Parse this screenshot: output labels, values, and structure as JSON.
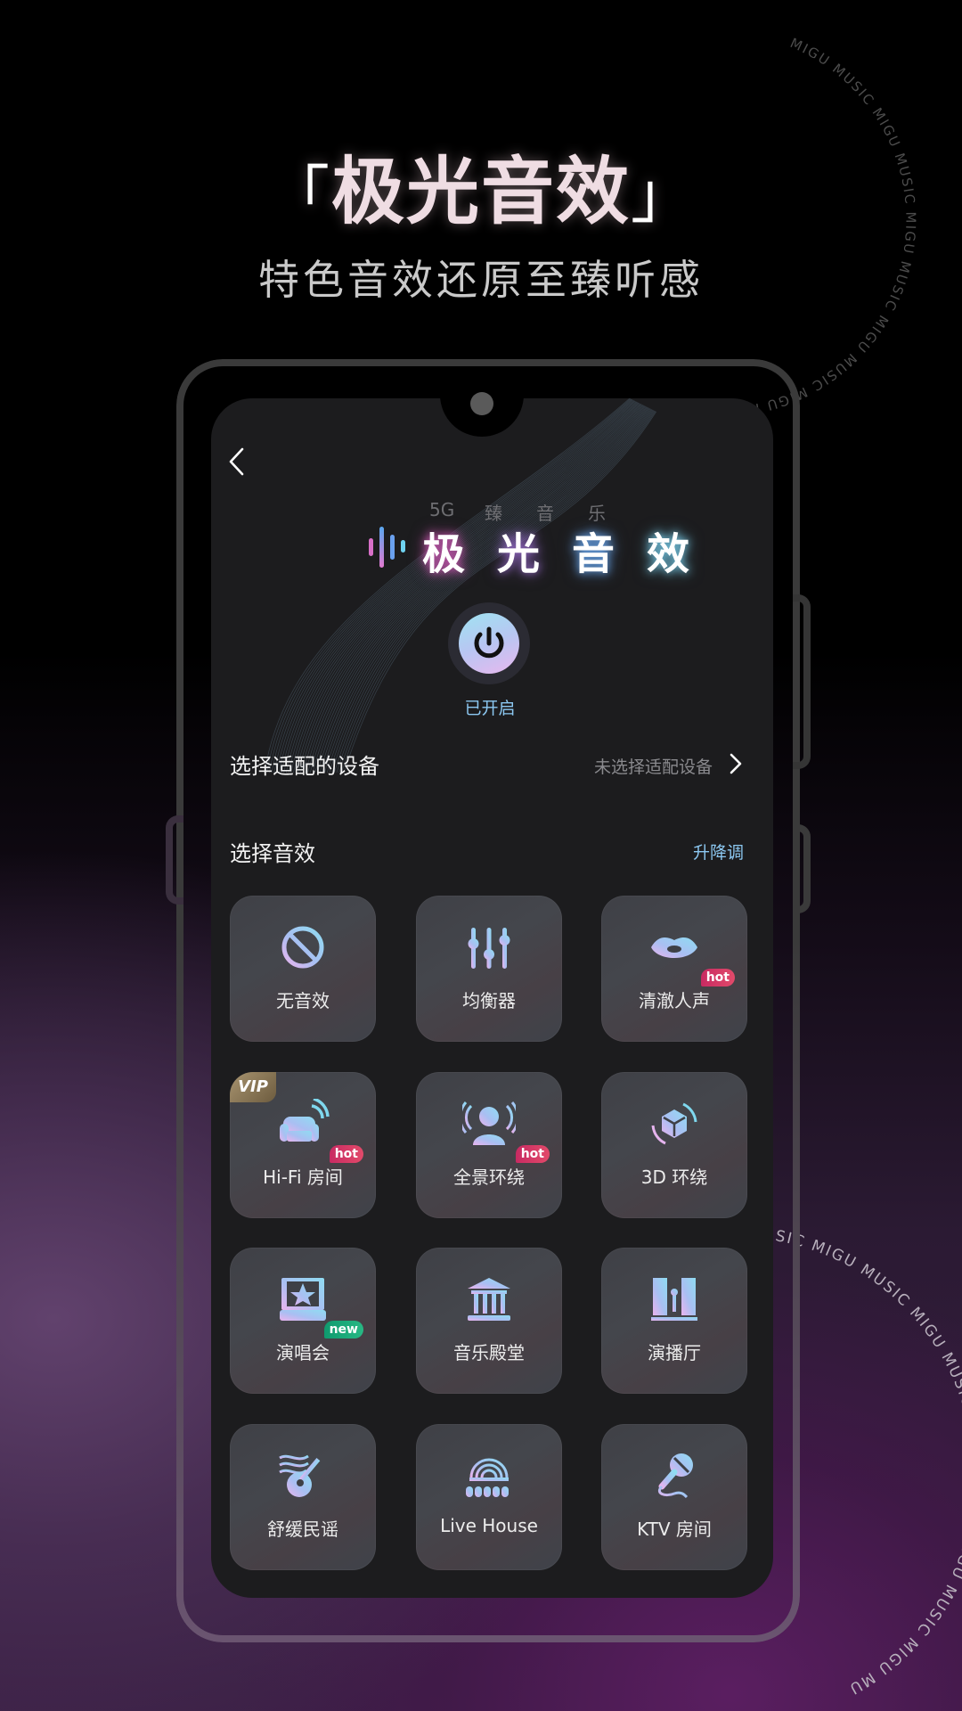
{
  "hero": {
    "bracket_open": "「",
    "title": "极光音效",
    "bracket_close": "」",
    "subtitle": "特色音效还原至臻听感"
  },
  "watermark": {
    "text": "MIGU MUSIC  MIGU MUSIC  MIGU MUSIC  MIGU MUSIC  MIGU MUSIC  ",
    "text_bottom": "SIC  MIGU MUSIC  MIGU MUSIC  MIGU MUSIC  MIGU MUSIC  MIGU MU"
  },
  "app": {
    "back_icon": "chevron-left-icon",
    "logo": {
      "tagline": [
        "5G",
        "臻",
        "音",
        "乐"
      ],
      "title_chars": [
        "极",
        "光",
        "音",
        "效"
      ],
      "bar_colors": [
        "#e27ad0",
        "#5aa8f0",
        "#6fd2f0"
      ]
    },
    "power": {
      "icon": "power-icon",
      "status": "已开启",
      "enabled": true
    },
    "device_row": {
      "title": "选择适配的设备",
      "value": "未选择适配设备",
      "chevron": "chevron-right-icon"
    },
    "effects_section": {
      "title": "选择音效",
      "pitch_link": "升降调"
    },
    "effects": [
      {
        "label": "无音效",
        "icon": "no-effect-icon",
        "badge": null,
        "vip": false
      },
      {
        "label": "均衡器",
        "icon": "equalizer-icon",
        "badge": null,
        "vip": false
      },
      {
        "label": "清澈人声",
        "icon": "lips-icon",
        "badge": "hot",
        "vip": false
      },
      {
        "label": "Hi-Fi 房间",
        "icon": "sofa-icon",
        "badge": "hot",
        "vip": true
      },
      {
        "label": "全景环绕",
        "icon": "person-surround-icon",
        "badge": "hot",
        "vip": false
      },
      {
        "label": "3D 环绕",
        "icon": "cube-3d-icon",
        "badge": null,
        "vip": false
      },
      {
        "label": "演唱会",
        "icon": "concert-stage-icon",
        "badge": "new",
        "vip": false
      },
      {
        "label": "音乐殿堂",
        "icon": "music-hall-icon",
        "badge": null,
        "vip": false
      },
      {
        "label": "演播厅",
        "icon": "studio-curtain-icon",
        "badge": null,
        "vip": false
      },
      {
        "label": "舒缓民谣",
        "icon": "guitar-icon",
        "badge": null,
        "vip": false
      },
      {
        "label": "Live House",
        "icon": "live-house-icon",
        "badge": null,
        "vip": false
      },
      {
        "label": "KTV 房间",
        "icon": "microphone-icon",
        "badge": null,
        "vip": false
      }
    ],
    "vip_label": "VIP",
    "colors": {
      "accent_blue": "#8cc8f2",
      "hot_badge": "#d63566",
      "new_badge": "#1aa878",
      "icon_gradient_start": "#8fdcf2",
      "icon_gradient_end": "#e6b4ee"
    }
  }
}
